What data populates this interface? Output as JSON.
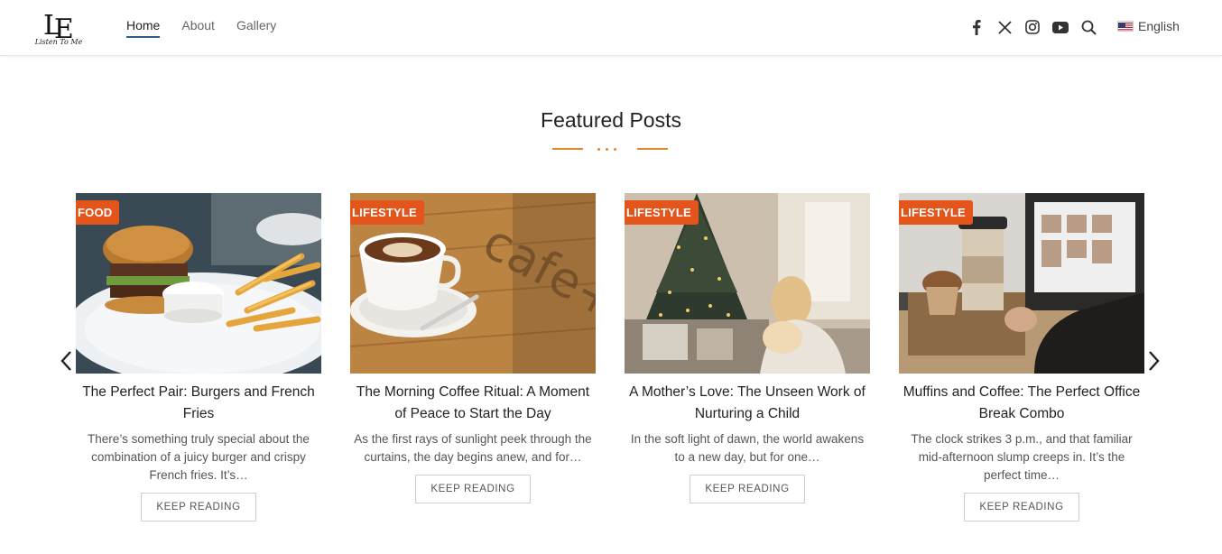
{
  "site": {
    "logo_mark": "LE",
    "logo_tagline": "Listen To Me"
  },
  "nav": {
    "items": [
      {
        "label": "Home",
        "active": true
      },
      {
        "label": "About",
        "active": false
      },
      {
        "label": "Gallery",
        "active": false
      }
    ]
  },
  "social": {
    "icons": [
      "facebook-icon",
      "x-icon",
      "instagram-icon",
      "youtube-icon",
      "search-icon"
    ]
  },
  "language": {
    "label": "English",
    "flag": "us-flag-icon"
  },
  "section": {
    "title": "Featured Posts"
  },
  "colors": {
    "accent": "#d98a2e",
    "badge": "#e3551a",
    "nav_underline": "#2f5d8a"
  },
  "posts": [
    {
      "category": "FOOD",
      "title": "The Perfect Pair: Burgers and French Fries",
      "excerpt": "There’s something truly special about the combination of a juicy burger and crispy French fries. It’s…",
      "button": "KEEP READING",
      "image": "burger-and-fries-photo"
    },
    {
      "category": "LIFESTYLE",
      "title": "The Morning Coffee Ritual: A Moment of Peace to Start the Day",
      "excerpt": "As the first rays of sunlight peek through the curtains, the day begins anew, and for…",
      "button": "KEEP READING",
      "image": "coffee-cup-photo"
    },
    {
      "category": "LIFESTYLE",
      "title": "A Mother’s Love: The Unseen Work of Nurturing a Child",
      "excerpt": "In the soft light of dawn, the world awakens to a new day, but for one…",
      "button": "KEEP READING",
      "image": "mother-christmas-tree-photo"
    },
    {
      "category": "LIFESTYLE",
      "title": "Muffins and Coffee: The Perfect Office Break Combo",
      "excerpt": "The clock strikes 3 p.m., and that familiar mid-afternoon slump creeps in. It’s the perfect time…",
      "button": "KEEP READING",
      "image": "muffin-coffee-laptop-photo"
    }
  ]
}
